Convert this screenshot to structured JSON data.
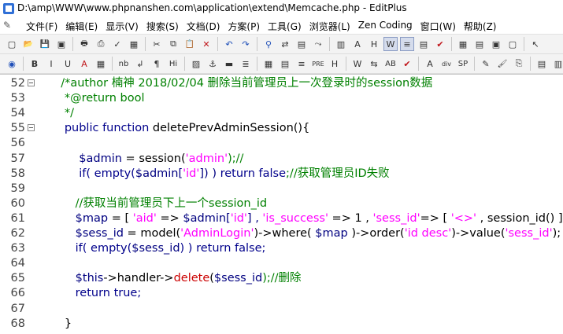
{
  "window": {
    "title": "D:\\amp\\WWW\\www.phpnanshen.com\\application\\extend\\Memcache.php - EditPlus"
  },
  "menu": [
    "文件(F)",
    "编辑(E)",
    "显示(V)",
    "搜索(S)",
    "文档(D)",
    "方案(P)",
    "工具(G)",
    "浏览器(L)",
    "Zen Coding",
    "窗口(W)",
    "帮助(Z)"
  ],
  "toolbar1": [
    {
      "name": "new-file-icon",
      "glyph": "▢"
    },
    {
      "name": "open-file-icon",
      "glyph": "📂"
    },
    {
      "name": "save-icon",
      "glyph": "💾"
    },
    {
      "name": "save-all-icon",
      "glyph": "▣"
    },
    {
      "name": "sep"
    },
    {
      "name": "print-icon",
      "glyph": "🖶"
    },
    {
      "name": "print-preview-icon",
      "glyph": "⎙"
    },
    {
      "name": "spellcheck-icon",
      "glyph": "✓"
    },
    {
      "name": "ftp-icon",
      "glyph": "▦"
    },
    {
      "name": "sep"
    },
    {
      "name": "cut-icon",
      "glyph": "✂"
    },
    {
      "name": "copy-icon",
      "glyph": "⧉"
    },
    {
      "name": "paste-icon",
      "glyph": "📋"
    },
    {
      "name": "delete-icon",
      "glyph": "✕"
    },
    {
      "name": "sep"
    },
    {
      "name": "undo-icon",
      "glyph": "↶"
    },
    {
      "name": "redo-icon",
      "glyph": "↷"
    },
    {
      "name": "sep"
    },
    {
      "name": "find-icon",
      "glyph": "⚲"
    },
    {
      "name": "replace-icon",
      "glyph": "⇄"
    },
    {
      "name": "find-in-files-icon",
      "glyph": "▤"
    },
    {
      "name": "goto-icon",
      "glyph": "⤳"
    },
    {
      "name": "sep"
    },
    {
      "name": "browser-view-icon",
      "glyph": "▥"
    },
    {
      "name": "html-toolbar-icon",
      "glyph": "A"
    },
    {
      "name": "font-icon",
      "glyph": "H"
    },
    {
      "name": "word-wrap-icon",
      "glyph": "W"
    },
    {
      "name": "line-number-icon",
      "glyph": "≡"
    },
    {
      "name": "column-select-icon",
      "glyph": "▤"
    },
    {
      "name": "check-icon",
      "glyph": "✔"
    },
    {
      "name": "sep"
    },
    {
      "name": "cliptext-icon",
      "glyph": "▦"
    },
    {
      "name": "directory-icon",
      "glyph": "▤"
    },
    {
      "name": "window-list-icon",
      "glyph": "▣"
    },
    {
      "name": "output-icon",
      "glyph": "▢"
    },
    {
      "name": "sep"
    },
    {
      "name": "help-icon",
      "glyph": "↖"
    }
  ],
  "toolbar2": [
    {
      "name": "web-browser-icon",
      "glyph": "◉"
    },
    {
      "name": "sep"
    },
    {
      "name": "bold-icon",
      "glyph": "B"
    },
    {
      "name": "italic-icon",
      "glyph": "I"
    },
    {
      "name": "underline-icon",
      "glyph": "U"
    },
    {
      "name": "font-color-icon",
      "glyph": "A"
    },
    {
      "name": "color-icon",
      "glyph": "▦"
    },
    {
      "name": "sep"
    },
    {
      "name": "nbsp-icon",
      "glyph": "nb"
    },
    {
      "name": "line-break-icon",
      "glyph": "↲"
    },
    {
      "name": "paragraph-icon",
      "glyph": "¶"
    },
    {
      "name": "heading-icon",
      "glyph": "Hi"
    },
    {
      "name": "sep"
    },
    {
      "name": "image-icon",
      "glyph": "▨"
    },
    {
      "name": "anchor-icon",
      "glyph": "⚓"
    },
    {
      "name": "hr-icon",
      "glyph": "▬"
    },
    {
      "name": "list-icon",
      "glyph": "≣"
    },
    {
      "name": "sep"
    },
    {
      "name": "table-icon",
      "glyph": "▦"
    },
    {
      "name": "form-icon",
      "glyph": "▤"
    },
    {
      "name": "center-icon",
      "glyph": "≡"
    },
    {
      "name": "pre-icon",
      "glyph": "PRE"
    },
    {
      "name": "marquee-icon",
      "glyph": "H"
    },
    {
      "name": "sep"
    },
    {
      "name": "width-icon",
      "glyph": "W"
    },
    {
      "name": "align-icon",
      "glyph": "⇆"
    },
    {
      "name": "tag-icon",
      "glyph": "AB"
    },
    {
      "name": "check-icon",
      "glyph": "✔"
    },
    {
      "name": "sep"
    },
    {
      "name": "font-tag-icon",
      "glyph": "A"
    },
    {
      "name": "div-icon",
      "glyph": "div"
    },
    {
      "name": "span-icon",
      "glyph": "SP"
    },
    {
      "name": "sep"
    },
    {
      "name": "edit-icon",
      "glyph": "✎"
    },
    {
      "name": "brush-icon",
      "glyph": "🖌"
    },
    {
      "name": "style-icon",
      "glyph": "⎘"
    },
    {
      "name": "sep"
    },
    {
      "name": "panel1-icon",
      "glyph": "▤"
    },
    {
      "name": "panel2-icon",
      "glyph": "▥"
    },
    {
      "name": "sep"
    },
    {
      "name": "preview-icon",
      "glyph": "▦"
    }
  ],
  "editor": {
    "lines": [
      {
        "num": "52",
        "fold": true,
        "tokens": [
          {
            "t": "  /*author 楠神 2018/02/04 删除当前管理员上一次登录时的session数据",
            "c": "comment"
          }
        ]
      },
      {
        "num": "53",
        "fold": false,
        "tokens": [
          {
            "t": "   *@return bool",
            "c": "comment"
          }
        ]
      },
      {
        "num": "54",
        "fold": false,
        "tokens": [
          {
            "t": "   */",
            "c": "comment"
          }
        ]
      },
      {
        "num": "55",
        "fold": true,
        "tokens": [
          {
            "t": "   public function ",
            "c": "kw"
          },
          {
            "t": "deletePrevAdminSession(){",
            "c": "plain"
          }
        ]
      },
      {
        "num": "56",
        "fold": false,
        "tokens": []
      },
      {
        "num": "57",
        "fold": false,
        "tokens": [
          {
            "t": "       $admin",
            "c": "var"
          },
          {
            "t": " = ",
            "c": "op"
          },
          {
            "t": "session(",
            "c": "plain"
          },
          {
            "t": "'admin'",
            "c": "tag"
          },
          {
            "t": ");//",
            "c": "comment"
          }
        ]
      },
      {
        "num": "58",
        "fold": false,
        "tokens": [
          {
            "t": "       if( empty(",
            "c": "kw"
          },
          {
            "t": "$admin[",
            "c": "var"
          },
          {
            "t": "'id'",
            "c": "tag"
          },
          {
            "t": "]) ) ",
            "c": "var"
          },
          {
            "t": "return false",
            "c": "kw"
          },
          {
            "t": ";//获取管理员ID失败",
            "c": "comment"
          }
        ]
      },
      {
        "num": "59",
        "fold": false,
        "tokens": []
      },
      {
        "num": "60",
        "fold": false,
        "tokens": [
          {
            "t": "      //获取当前管理员下上一个session_id",
            "c": "comment"
          }
        ]
      },
      {
        "num": "61",
        "fold": false,
        "tokens": [
          {
            "t": "      $map",
            "c": "var"
          },
          {
            "t": " = [ ",
            "c": "op"
          },
          {
            "t": "'aid'",
            "c": "tag"
          },
          {
            "t": " => ",
            "c": "op"
          },
          {
            "t": "$admin[",
            "c": "var"
          },
          {
            "t": "'id'",
            "c": "tag"
          },
          {
            "t": "] , ",
            "c": "var"
          },
          {
            "t": "'is_success'",
            "c": "tag"
          },
          {
            "t": " => 1 , ",
            "c": "op"
          },
          {
            "t": "'sess_id'",
            "c": "tag"
          },
          {
            "t": "=> [ ",
            "c": "op"
          },
          {
            "t": "'<>'",
            "c": "tag"
          },
          {
            "t": " , session_id() ] ];",
            "c": "plain"
          }
        ]
      },
      {
        "num": "62",
        "fold": false,
        "tokens": [
          {
            "t": "      $sess_id",
            "c": "var"
          },
          {
            "t": " = model(",
            "c": "plain"
          },
          {
            "t": "'AdminLogin'",
            "c": "tag"
          },
          {
            "t": ")->where( ",
            "c": "plain"
          },
          {
            "t": "$map",
            "c": "var"
          },
          {
            "t": " )->order(",
            "c": "plain"
          },
          {
            "t": "'id desc'",
            "c": "tag"
          },
          {
            "t": ")->value(",
            "c": "plain"
          },
          {
            "t": "'sess_id'",
            "c": "tag"
          },
          {
            "t": ");",
            "c": "plain"
          }
        ]
      },
      {
        "num": "63",
        "fold": false,
        "tokens": [
          {
            "t": "      if( empty(",
            "c": "kw"
          },
          {
            "t": "$sess_id",
            "c": "var"
          },
          {
            "t": ") ) return false;",
            "c": "kw"
          }
        ]
      },
      {
        "num": "64",
        "fold": false,
        "tokens": []
      },
      {
        "num": "65",
        "fold": false,
        "tokens": [
          {
            "t": "      $this",
            "c": "var"
          },
          {
            "t": "->handler->",
            "c": "plain"
          },
          {
            "t": "delete",
            "c": "fn"
          },
          {
            "t": "(",
            "c": "plain"
          },
          {
            "t": "$sess_id",
            "c": "var"
          },
          {
            "t": ");//删除",
            "c": "comment"
          }
        ]
      },
      {
        "num": "66",
        "fold": false,
        "tokens": [
          {
            "t": "      return true;",
            "c": "kw"
          }
        ]
      },
      {
        "num": "67",
        "fold": false,
        "tokens": []
      },
      {
        "num": "68",
        "fold": false,
        "tokens": [
          {
            "t": "   }",
            "c": "plain"
          }
        ]
      }
    ]
  }
}
